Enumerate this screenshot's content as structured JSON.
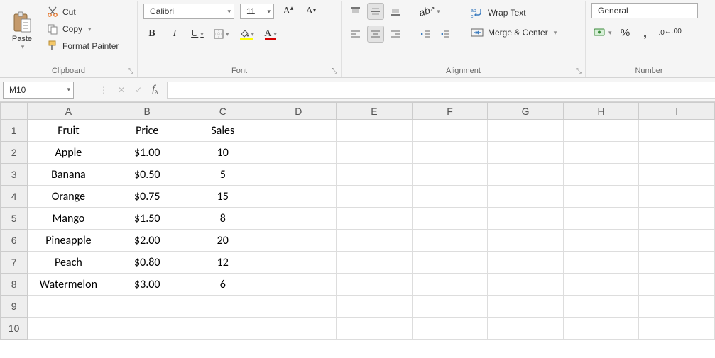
{
  "ribbon": {
    "clipboard": {
      "paste": "Paste",
      "cut": "Cut",
      "copy": "Copy",
      "format_painter": "Format Painter",
      "label": "Clipboard"
    },
    "font": {
      "name": "Calibri",
      "size": "11",
      "label": "Font"
    },
    "alignment": {
      "wrap": "Wrap Text",
      "merge": "Merge & Center",
      "label": "Alignment"
    },
    "number": {
      "format": "General",
      "label": "Number"
    }
  },
  "name_box": "M10",
  "columns": [
    "A",
    "B",
    "C",
    "D",
    "E",
    "F",
    "G",
    "H",
    "I"
  ],
  "rows": [
    "1",
    "2",
    "3",
    "4",
    "5",
    "6",
    "7",
    "8",
    "9",
    "10"
  ],
  "cells": {
    "A1": "Fruit",
    "B1": "Price",
    "C1": "Sales",
    "A2": "Apple",
    "B2": "$1.00",
    "C2": "10",
    "A3": "Banana",
    "B3": "$0.50",
    "C3": "5",
    "A4": "Orange",
    "B4": "$0.75",
    "C4": "15",
    "A5": "Mango",
    "B5": "$1.50",
    "C5": "8",
    "A6": "Pineapple",
    "B6": "$2.00",
    "C6": "20",
    "A7": "Peach",
    "B7": "$0.80",
    "C7": "12",
    "A8": "Watermelon",
    "B8": "$3.00",
    "C8": "6"
  },
  "selected_cell": "M10"
}
